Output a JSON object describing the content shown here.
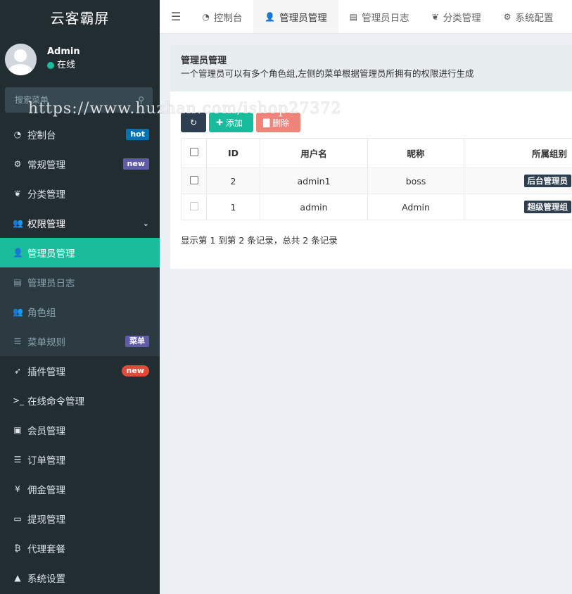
{
  "app": {
    "title": "云客霸屏"
  },
  "user": {
    "name": "Admin",
    "status": "在线"
  },
  "search": {
    "placeholder": "搜索菜单"
  },
  "sidebar": {
    "items": [
      {
        "label": "控制台",
        "icon": "dashboard-icon",
        "glyph": "◔",
        "badge": "hot"
      },
      {
        "label": "常规管理",
        "icon": "cogs-icon",
        "glyph": "⚙",
        "badge": "new"
      },
      {
        "label": "分类管理",
        "icon": "leaf-icon",
        "glyph": "❦"
      },
      {
        "label": "权限管理",
        "icon": "users-icon",
        "glyph": "👥"
      },
      {
        "label": "插件管理",
        "icon": "rocket-icon",
        "glyph": "➶",
        "badge": "new"
      },
      {
        "label": "在线命令管理",
        "icon": "terminal-icon",
        "glyph": ">_"
      },
      {
        "label": "会员管理",
        "icon": "id-card-icon",
        "glyph": "▣"
      },
      {
        "label": "订单管理",
        "icon": "list-icon",
        "glyph": "☰"
      },
      {
        "label": "佣金管理",
        "icon": "yen-icon",
        "glyph": "¥"
      },
      {
        "label": "提现管理",
        "icon": "paypal-card-icon",
        "glyph": "▭"
      },
      {
        "label": "代理套餐",
        "icon": "bitcoin-icon",
        "glyph": "₿"
      },
      {
        "label": "系统设置",
        "icon": "warning-icon",
        "glyph": "▲"
      }
    ],
    "submenu": [
      {
        "label": "管理员管理",
        "icon": "user-icon",
        "glyph": "👤"
      },
      {
        "label": "管理员日志",
        "icon": "list-alt-icon",
        "glyph": "▤"
      },
      {
        "label": "角色组",
        "icon": "group-icon",
        "glyph": "👥"
      },
      {
        "label": "菜单规则",
        "icon": "bars-icon",
        "glyph": "☰",
        "badge": "菜单"
      }
    ]
  },
  "tabs": [
    {
      "label": "控制台",
      "glyph": "◔"
    },
    {
      "label": "管理员管理",
      "glyph": "👤"
    },
    {
      "label": "管理员日志",
      "glyph": "▤"
    },
    {
      "label": "分类管理",
      "glyph": "❦"
    },
    {
      "label": "系统配置",
      "glyph": "⚙"
    }
  ],
  "panel": {
    "title": "管理员管理",
    "description": "一个管理员可以有多个角色组,左侧的菜单根据管理员所拥有的权限进行生成"
  },
  "toolbar": {
    "add_label": "添加",
    "delete_label": "删除"
  },
  "table": {
    "headers": [
      "ID",
      "用户名",
      "昵称",
      "所属组别"
    ],
    "rows": [
      {
        "id": "2",
        "username": "admin1",
        "nickname": "boss",
        "group": "后台管理员"
      },
      {
        "id": "1",
        "username": "admin",
        "nickname": "Admin",
        "group": "超级管理组"
      }
    ],
    "summary": "显示第 1 到第 2 条记录，总共 2 条记录"
  },
  "watermark": "https://www.huzhan.com/ishop27372",
  "colors": {
    "accent": "#1abc9c",
    "sidebar": "#222d32",
    "dark": "#2c3e50",
    "danger": "#f0837a"
  }
}
